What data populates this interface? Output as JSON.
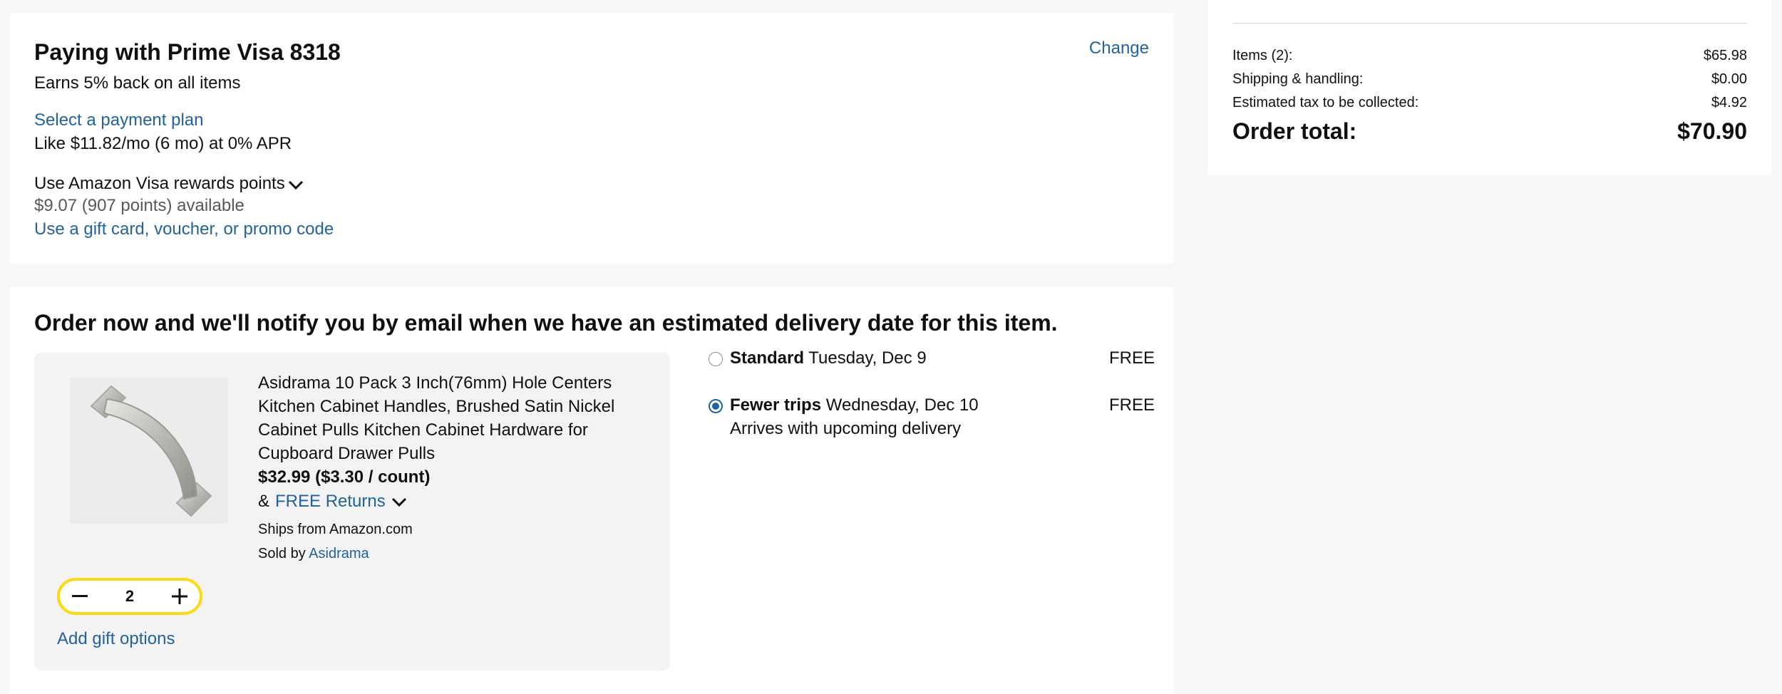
{
  "payment": {
    "title": "Paying with Prime Visa 8318",
    "subtitle": "Earns 5% back on all items",
    "change_label": "Change",
    "plan_link": "Select a payment plan",
    "plan_text": "Like $11.82/mo (6 mo) at 0% APR",
    "points_label": "Use Amazon Visa rewards points",
    "points_available": "$9.07 (907 points) available",
    "gift_link": "Use a gift card, voucher, or promo code"
  },
  "delivery": {
    "title": "Order now and we'll notify you by email when we have an estimated delivery date for this item.",
    "item": {
      "title": "Asidrama 10 Pack 3 Inch(76mm) Hole Centers Kitchen Cabinet Handles, Brushed Satin Nickel Cabinet Pulls Kitchen Cabinet Hardware for Cupboard Drawer Pulls",
      "price": "$32.99 ($3.30 / count)",
      "returns_prefix": "&",
      "returns_link": "FREE Returns",
      "ships_from": "Ships from Amazon.com",
      "sold_by_prefix": "Sold by",
      "seller": "Asidrama",
      "quantity": "2",
      "gift_options": "Add gift options"
    },
    "options": [
      {
        "name": "Standard",
        "date": "Tuesday, Dec 9",
        "note": "",
        "price": "FREE",
        "selected": false
      },
      {
        "name": "Fewer trips",
        "date": "Wednesday, Dec 10",
        "note": "Arrives with upcoming delivery",
        "price": "FREE",
        "selected": true
      }
    ]
  },
  "summary": {
    "rows": [
      {
        "label": "Items (2):",
        "value": "$65.98"
      },
      {
        "label": "Shipping & handling:",
        "value": "$0.00"
      },
      {
        "label": "Estimated tax to be collected:",
        "value": "$4.92"
      }
    ],
    "total_label": "Order total:",
    "total_value": "$70.90"
  },
  "colors": {
    "link": "#2162a1",
    "stepper_border": "#ffd814",
    "page_bg": "#f7f7f7"
  }
}
